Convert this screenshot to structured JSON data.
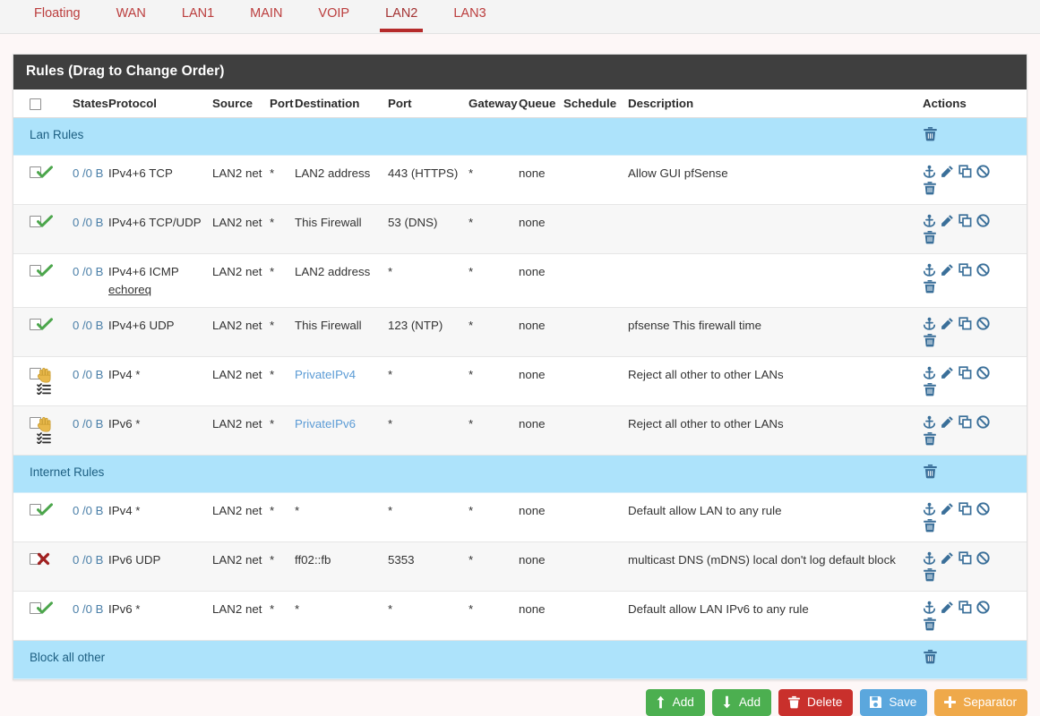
{
  "tabs": [
    {
      "label": "Floating",
      "active": false
    },
    {
      "label": "WAN",
      "active": false
    },
    {
      "label": "LAN1",
      "active": false
    },
    {
      "label": "MAIN",
      "active": false
    },
    {
      "label": "VOIP",
      "active": false
    },
    {
      "label": "LAN2",
      "active": true
    },
    {
      "label": "LAN3",
      "active": false
    }
  ],
  "panel": {
    "title": "Rules (Drag to Change Order)"
  },
  "colors": {
    "tab_accent": "#b52b2b",
    "panel_header_bg": "#3f3f3f",
    "separator_bg": "#ade3fb",
    "separator_text": "#1d5f82",
    "pass_icon": "#4ca64c",
    "block_icon": "#a02020",
    "reject_icon": "#e8b84b",
    "action_icon": "#3a6f99",
    "link": "#4a7fa8"
  },
  "table": {
    "columns": [
      {
        "key": "checkbox",
        "label": ""
      },
      {
        "key": "action",
        "label": ""
      },
      {
        "key": "states",
        "label": "States"
      },
      {
        "key": "protocol",
        "label": "Protocol"
      },
      {
        "key": "source",
        "label": "Source"
      },
      {
        "key": "sport",
        "label": "Port"
      },
      {
        "key": "destination",
        "label": "Destination"
      },
      {
        "key": "dport",
        "label": "Port"
      },
      {
        "key": "gateway",
        "label": "Gateway"
      },
      {
        "key": "queue",
        "label": "Queue"
      },
      {
        "key": "schedule",
        "label": "Schedule"
      },
      {
        "key": "description",
        "label": "Description"
      },
      {
        "key": "actions",
        "label": "Actions"
      }
    ],
    "rows": [
      {
        "kind": "separator",
        "label": "Lan Rules"
      },
      {
        "kind": "rule",
        "action_icon": "pass-check-icon",
        "second_icon": "",
        "states": "0 /0 B",
        "protocol": "IPv4+6 TCP",
        "protocol_sub": "",
        "source": "LAN2 net",
        "sport": "*",
        "destination": "LAN2 address",
        "destination_link": false,
        "dport": "443 (HTTPS)",
        "gateway": "*",
        "queue": "none",
        "schedule": "",
        "description": "Allow GUI pfSense"
      },
      {
        "kind": "rule",
        "action_icon": "pass-check-icon",
        "second_icon": "",
        "states": "0 /0 B",
        "protocol": "IPv4+6 TCP/UDP",
        "protocol_sub": "",
        "source": "LAN2 net",
        "sport": "*",
        "destination": "This Firewall",
        "destination_link": false,
        "dport": "53 (DNS)",
        "gateway": "*",
        "queue": "none",
        "schedule": "",
        "description": ""
      },
      {
        "kind": "rule",
        "action_icon": "pass-check-icon",
        "second_icon": "",
        "states": "0 /0 B",
        "protocol": "IPv4+6 ICMP",
        "protocol_sub": "echoreq",
        "source": "LAN2 net",
        "sport": "*",
        "destination": "LAN2 address",
        "destination_link": false,
        "dport": "*",
        "gateway": "*",
        "queue": "none",
        "schedule": "",
        "description": ""
      },
      {
        "kind": "rule",
        "action_icon": "pass-check-icon",
        "second_icon": "",
        "states": "0 /0 B",
        "protocol": "IPv4+6 UDP",
        "protocol_sub": "",
        "source": "LAN2 net",
        "sport": "*",
        "destination": "This Firewall",
        "destination_link": false,
        "dport": "123 (NTP)",
        "gateway": "*",
        "queue": "none",
        "schedule": "",
        "description": "pfsense This firewall time"
      },
      {
        "kind": "rule",
        "action_icon": "reject-hand-icon",
        "second_icon": "tasks-list-icon",
        "states": "0 /0 B",
        "protocol": "IPv4 *",
        "protocol_sub": "",
        "source": "LAN2 net",
        "sport": "*",
        "destination": "PrivateIPv4",
        "destination_link": true,
        "dport": "*",
        "gateway": "*",
        "queue": "none",
        "schedule": "",
        "description": "Reject all other to other LANs"
      },
      {
        "kind": "rule",
        "action_icon": "reject-hand-icon",
        "second_icon": "tasks-list-icon",
        "states": "0 /0 B",
        "protocol": "IPv6 *",
        "protocol_sub": "",
        "source": "LAN2 net",
        "sport": "*",
        "destination": "PrivateIPv6",
        "destination_link": true,
        "dport": "*",
        "gateway": "*",
        "queue": "none",
        "schedule": "",
        "description": "Reject all other to other LANs"
      },
      {
        "kind": "separator",
        "label": "Internet Rules"
      },
      {
        "kind": "rule",
        "action_icon": "pass-check-icon",
        "second_icon": "",
        "states": "0 /0 B",
        "protocol": "IPv4 *",
        "protocol_sub": "",
        "source": "LAN2 net",
        "sport": "*",
        "destination": "*",
        "destination_link": false,
        "dport": "*",
        "gateway": "*",
        "queue": "none",
        "schedule": "",
        "description": "Default allow LAN to any rule"
      },
      {
        "kind": "rule",
        "action_icon": "block-x-icon",
        "second_icon": "",
        "states": "0 /0 B",
        "protocol": "IPv6 UDP",
        "protocol_sub": "",
        "source": "LAN2 net",
        "sport": "*",
        "destination": "ff02::fb",
        "destination_link": false,
        "dport": "5353",
        "gateway": "*",
        "queue": "none",
        "schedule": "",
        "description": "multicast DNS (mDNS) local don't log default block"
      },
      {
        "kind": "rule",
        "action_icon": "pass-check-icon",
        "second_icon": "",
        "states": "0 /0 B",
        "protocol": "IPv6 *",
        "protocol_sub": "",
        "source": "LAN2 net",
        "sport": "*",
        "destination": "*",
        "destination_link": false,
        "dport": "*",
        "gateway": "*",
        "queue": "none",
        "schedule": "",
        "description": "Default allow LAN IPv6 to any rule"
      },
      {
        "kind": "separator",
        "label": "Block all other"
      }
    ],
    "row_action_icons": [
      "anchor-icon",
      "pencil-edit-icon",
      "copy-duplicate-icon",
      "ban-disable-icon",
      "trash-delete-icon"
    ],
    "separator_action_icons": [
      "trash-delete-icon"
    ]
  },
  "buttons": [
    {
      "label": "Add",
      "icon": "arrow-up-icon",
      "style": "green",
      "name": "add-rule-top-button"
    },
    {
      "label": "Add",
      "icon": "arrow-down-icon",
      "style": "green",
      "name": "add-rule-bottom-button"
    },
    {
      "label": "Delete",
      "icon": "trash-delete-icon",
      "style": "red",
      "name": "delete-button"
    },
    {
      "label": "Save",
      "icon": "save-disk-icon",
      "style": "blue",
      "name": "save-button"
    },
    {
      "label": "Separator",
      "icon": "plus-icon",
      "style": "orange",
      "name": "separator-button"
    }
  ]
}
